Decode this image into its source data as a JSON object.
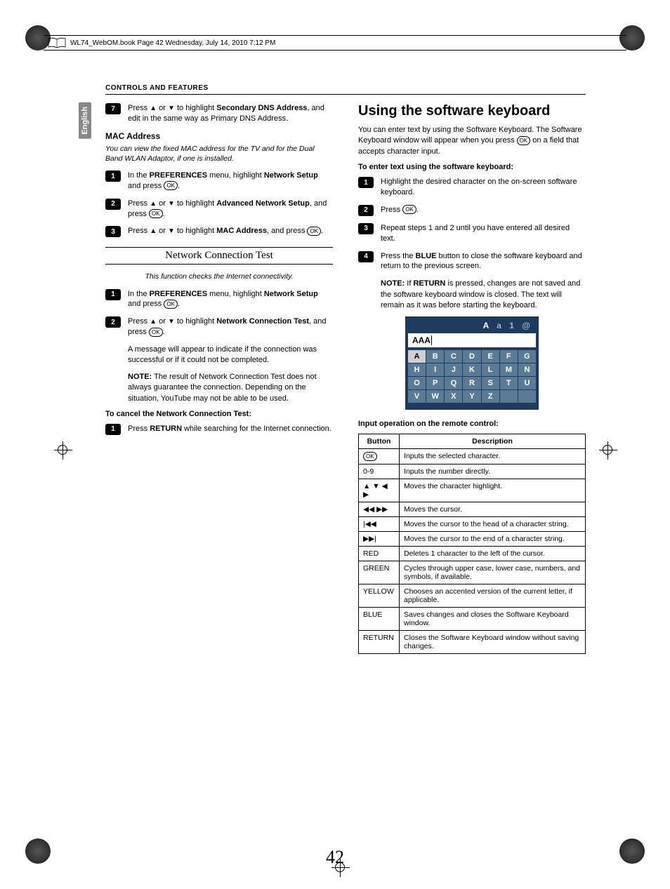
{
  "header_line": "WL74_WebOM.book  Page 42  Wednesday, July 14, 2010  7:12 PM",
  "section_header": "CONTROLS AND FEATURES",
  "side_tab": "English",
  "page_number": "42",
  "left": {
    "step7": {
      "num": "7",
      "text_a": "Press ",
      "text_b": " or ",
      "text_c": " to highlight ",
      "bold": "Secondary DNS Address",
      "text_d": ", and edit in the same way as Primary DNS Address."
    },
    "mac_heading": "MAC Address",
    "mac_intro": "You can view the fixed MAC address for the TV and for the Dual Band WLAN Adaptor, if one is installed.",
    "mac_step1": {
      "num": "1",
      "a": "In the ",
      "b": "PREFERENCES",
      "c": " menu, highlight ",
      "d": "Network Setup",
      "e": " and press ",
      "f": "."
    },
    "mac_step2": {
      "num": "2",
      "a": "Press ",
      "b": " or ",
      "c": " to highlight ",
      "d": "Advanced Network Setup",
      "e": ", and press ",
      "f": "."
    },
    "mac_step3": {
      "num": "3",
      "a": "Press ",
      "b": " or ",
      "c": " to highlight ",
      "d": "MAC Address",
      "e": ", and press ",
      "f": "."
    },
    "nct_heading": "Network Connection Test",
    "nct_intro": "This function checks the Internet connectivity.",
    "nct_step1": {
      "num": "1",
      "a": "In the ",
      "b": "PREFERENCES",
      "c": " menu, highlight ",
      "d": "Network Setup",
      "e": " and press ",
      "f": "."
    },
    "nct_step2": {
      "num": "2",
      "a": "Press ",
      "b": " or ",
      "c": " to highlight ",
      "d": "Network Connection Test",
      "e": ", and press ",
      "f": "."
    },
    "nct_msg": "A message will appear to indicate if the connection was successful or if it could not be completed.",
    "nct_note": {
      "label": "NOTE:",
      "text": " The result of Network Connection Test does not always guarantee the connection. Depending on the situation, YouTube may not be able to be used."
    },
    "cancel_heading": "To cancel the Network Connection Test:",
    "cancel_step1": {
      "num": "1",
      "a": "Press ",
      "b": "RETURN",
      "c": " while searching for the Internet connection."
    }
  },
  "right": {
    "big_heading": "Using the software keyboard",
    "intro_a": "You can enter text by using the Software Keyboard. The Software Keyboard window will appear when you press ",
    "intro_b": " on a field that accepts character input.",
    "enter_heading": "To enter text using the software keyboard:",
    "r_step1": {
      "num": "1",
      "text": "Highlight the desired character on the on-screen software keyboard."
    },
    "r_step2": {
      "num": "2",
      "a": "Press ",
      "b": "."
    },
    "r_step3": {
      "num": "3",
      "text": "Repeat steps 1 and 2 until you have entered all desired text."
    },
    "r_step4": {
      "num": "4",
      "a": "Press the ",
      "b": "BLUE",
      "c": " button to close the software keyboard and return to the previous screen."
    },
    "r_note": {
      "label": "NOTE:",
      "a": " If ",
      "b": "RETURN",
      "c": " is pressed, changes are not saved and the software keyboard window is closed. The text will remain as it was before starting the keyboard."
    },
    "kb_modes": [
      "A",
      "a",
      "1",
      "@"
    ],
    "kb_input": "AAA",
    "kb_keys": [
      "A",
      "B",
      "C",
      "D",
      "E",
      "F",
      "G",
      "H",
      "I",
      "J",
      "K",
      "L",
      "M",
      "N",
      "O",
      "P",
      "Q",
      "R",
      "S",
      "T",
      "U",
      "V",
      "W",
      "X",
      "Y",
      "Z",
      "",
      ""
    ],
    "table_heading": "Input operation on the remote control:",
    "table_headers": [
      "Button",
      "Description"
    ],
    "table_rows": [
      {
        "btn": "OK",
        "is_ok": true,
        "desc": "Inputs the selected character."
      },
      {
        "btn": "0-9",
        "desc": "Inputs the number directly."
      },
      {
        "btn": "▲ ▼ ◀ ▶",
        "desc": "Moves the character highlight."
      },
      {
        "btn": "◀◀ ▶▶",
        "desc": "Moves the cursor."
      },
      {
        "btn": "|◀◀",
        "desc": "Moves the cursor to the head of a character string."
      },
      {
        "btn": "▶▶|",
        "desc": "Moves the cursor to the end of a character string."
      },
      {
        "btn": "RED",
        "desc": "Deletes 1 character to the left of the cursor."
      },
      {
        "btn": "GREEN",
        "desc": "Cycles through upper case, lower case, numbers, and symbols, if available."
      },
      {
        "btn": "YELLOW",
        "desc": "Chooses an accented version of the current letter, if applicable."
      },
      {
        "btn": "BLUE",
        "desc": "Saves changes and closes the Software Keyboard window."
      },
      {
        "btn": "RETURN",
        "desc": "Closes the Software Keyboard window without saving changes."
      }
    ]
  },
  "symbols": {
    "ok": "OK",
    "up": "▲",
    "down": "▼"
  }
}
